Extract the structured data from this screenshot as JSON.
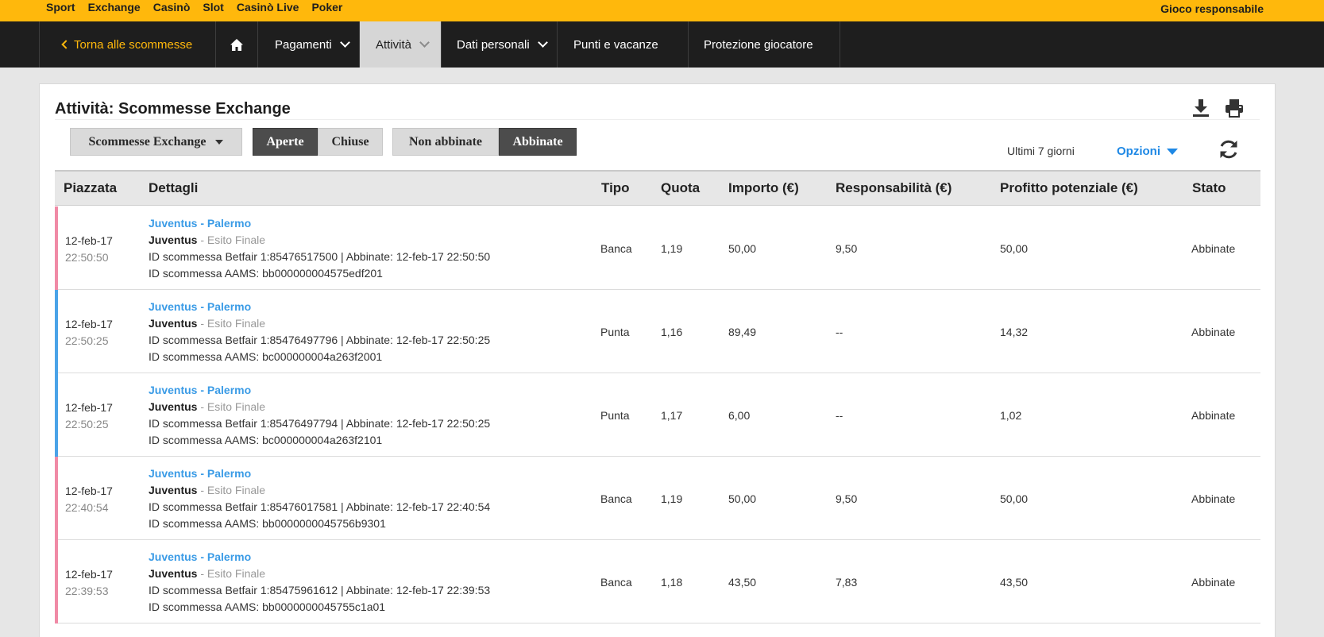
{
  "topbar": {
    "links": [
      "Sport",
      "Exchange",
      "Casinò",
      "Slot",
      "Casinò Live",
      "Poker"
    ],
    "responsible": "Gioco responsabile"
  },
  "nav": {
    "back": "Torna alle scommesse",
    "items": [
      "Pagamenti",
      "Attività",
      "Dati personali",
      "Punti e vacanze",
      "Protezione giocatore"
    ]
  },
  "page": {
    "title": "Attività: Scommesse Exchange"
  },
  "filters": {
    "type_select": "Scommesse Exchange",
    "open": "Aperte",
    "closed": "Chiuse",
    "unmatched": "Non abbinate",
    "matched": "Abbinate",
    "period": "Ultimi 7 giorni",
    "options": "Opzioni"
  },
  "table": {
    "headers": [
      "Piazzata",
      "Dettagli",
      "Tipo",
      "Quota",
      "Importo (€)",
      "Responsabilità (€)",
      "Profitto potenziale (€)",
      "Stato"
    ],
    "rows": [
      {
        "date": "12-feb-17",
        "time": "22:50:50",
        "event": "Juventus - Palermo",
        "selection": "Juventus",
        "market": " - Esito Finale",
        "betfair_id": "ID scommessa Betfair 1:85476517500 | Abbinate: 12-feb-17 22:50:50",
        "aams_id": "ID scommessa AAMS: bb000000004575edf201",
        "type": "Banca",
        "odds": "1,19",
        "stake": "50,00",
        "liability": "9,50",
        "profit": "50,00",
        "status": "Abbinate",
        "color": "#f08aa6"
      },
      {
        "date": "12-feb-17",
        "time": "22:50:25",
        "event": "Juventus - Palermo",
        "selection": "Juventus",
        "market": " - Esito Finale",
        "betfair_id": "ID scommessa Betfair 1:85476497796 | Abbinate: 12-feb-17 22:50:25",
        "aams_id": "ID scommessa AAMS: bc000000004a263f2001",
        "type": "Punta",
        "odds": "1,16",
        "stake": "89,49",
        "liability": "--",
        "profit": "14,32",
        "status": "Abbinate",
        "color": "#4aa3e8"
      },
      {
        "date": "12-feb-17",
        "time": "22:50:25",
        "event": "Juventus - Palermo",
        "selection": "Juventus",
        "market": " - Esito Finale",
        "betfair_id": "ID scommessa Betfair 1:85476497794 | Abbinate: 12-feb-17 22:50:25",
        "aams_id": "ID scommessa AAMS: bc000000004a263f2101",
        "type": "Punta",
        "odds": "1,17",
        "stake": "6,00",
        "liability": "--",
        "profit": "1,02",
        "status": "Abbinate",
        "color": "#4aa3e8"
      },
      {
        "date": "12-feb-17",
        "time": "22:40:54",
        "event": "Juventus - Palermo",
        "selection": "Juventus",
        "market": " - Esito Finale",
        "betfair_id": "ID scommessa Betfair 1:85476017581 | Abbinate: 12-feb-17 22:40:54",
        "aams_id": "ID scommessa AAMS: bb0000000045756b9301",
        "type": "Banca",
        "odds": "1,19",
        "stake": "50,00",
        "liability": "9,50",
        "profit": "50,00",
        "status": "Abbinate",
        "color": "#f08aa6"
      },
      {
        "date": "12-feb-17",
        "time": "22:39:53",
        "event": "Juventus - Palermo",
        "selection": "Juventus",
        "market": " - Esito Finale",
        "betfair_id": "ID scommessa Betfair 1:85475961612 | Abbinate: 12-feb-17 22:39:53",
        "aams_id": "ID scommessa AAMS: bb0000000045755c1a01",
        "type": "Banca",
        "odds": "1,18",
        "stake": "43,50",
        "liability": "7,83",
        "profit": "43,50",
        "status": "Abbinate",
        "color": "#f08aa6"
      }
    ]
  },
  "icons": {
    "download": "download-icon",
    "print": "print-icon",
    "refresh": "refresh-icon",
    "home": "home-icon"
  }
}
